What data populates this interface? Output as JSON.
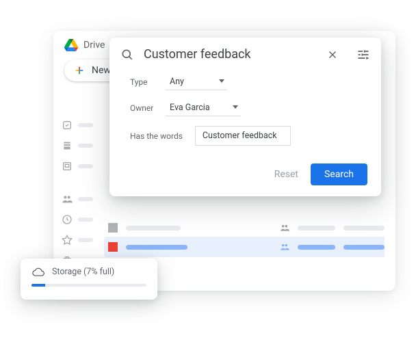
{
  "app": {
    "title": "Drive",
    "new_label": "New"
  },
  "search": {
    "query": "Customer feedback",
    "filters": {
      "type_label": "Type",
      "type_value": "Any",
      "owner_label": "Owner",
      "owner_value": "Eva Garcia",
      "htw_label": "Has the words",
      "htw_value": "Customer feedback"
    },
    "reset": "Reset",
    "submit": "Search"
  },
  "storage": {
    "label": "Storage (7% full)",
    "percent": 7
  }
}
